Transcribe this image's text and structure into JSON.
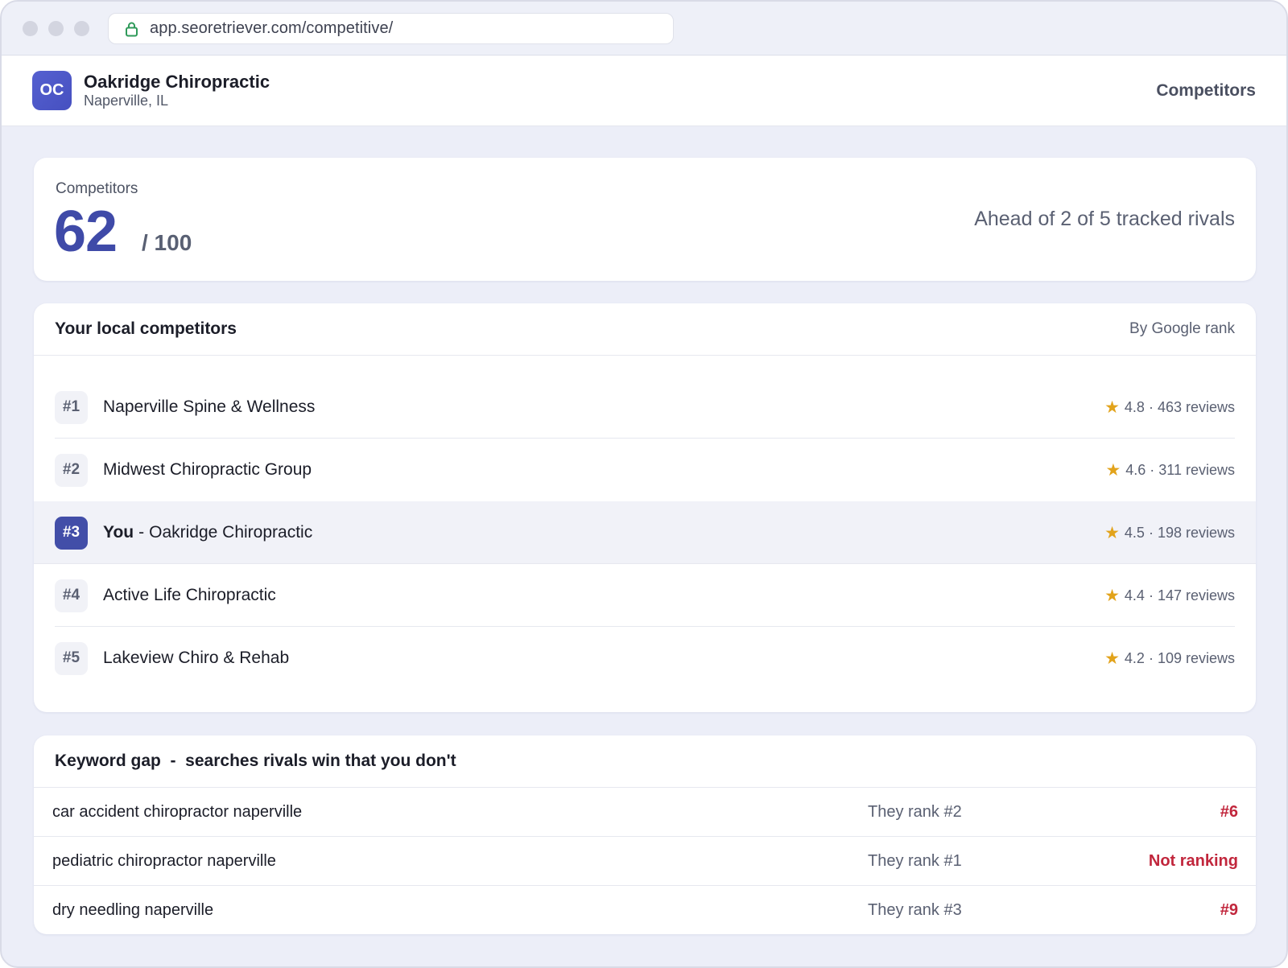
{
  "browser": {
    "url": "app.seoretriever.com/competitive/"
  },
  "header": {
    "avatar_initials": "OC",
    "business_name": "Oakridge Chiropractic",
    "location": "Naperville, IL",
    "nav_current": "Competitors"
  },
  "score": {
    "label": "Competitors",
    "value": "62",
    "max": "/ 100",
    "summary": "Ahead of 2 of 5 tracked rivals"
  },
  "competitors": {
    "title": "Your local competitors",
    "sort_label": "By Google rank",
    "star_glyph": "★",
    "star_color": "#e2a31b",
    "you_label": "You",
    "you_separator": "-",
    "rows": [
      {
        "rank": "#1",
        "name": "Naperville Spine & Wellness",
        "rating": "4.8 · 463 reviews",
        "is_you": false
      },
      {
        "rank": "#2",
        "name": "Midwest Chiropractic Group",
        "rating": "4.6 · 311 reviews",
        "is_you": false
      },
      {
        "rank": "#3",
        "name": "Oakridge Chiropractic",
        "rating": "4.5 · 198 reviews",
        "is_you": true
      },
      {
        "rank": "#4",
        "name": "Active Life Chiropractic",
        "rating": "4.4 · 147 reviews",
        "is_you": false
      },
      {
        "rank": "#5",
        "name": "Lakeview Chiro & Rehab",
        "rating": "4.2 · 109 reviews",
        "is_you": false
      }
    ]
  },
  "keyword_gap": {
    "title": "Keyword gap  -  searches rivals win that you don't",
    "rows": [
      {
        "term": "car accident chiropractor naperville",
        "they": "They rank #2",
        "you": "#6"
      },
      {
        "term": "pediatric chiropractor naperville",
        "they": "They rank #1",
        "you": "Not ranking"
      },
      {
        "term": "dry needling naperville",
        "they": "They rank #3",
        "you": "#9"
      }
    ]
  },
  "colors": {
    "accent": "#424ea8",
    "score_value": "#3f4aa8",
    "gap_red": "#c1263c",
    "page_bg": "#eceef8"
  }
}
